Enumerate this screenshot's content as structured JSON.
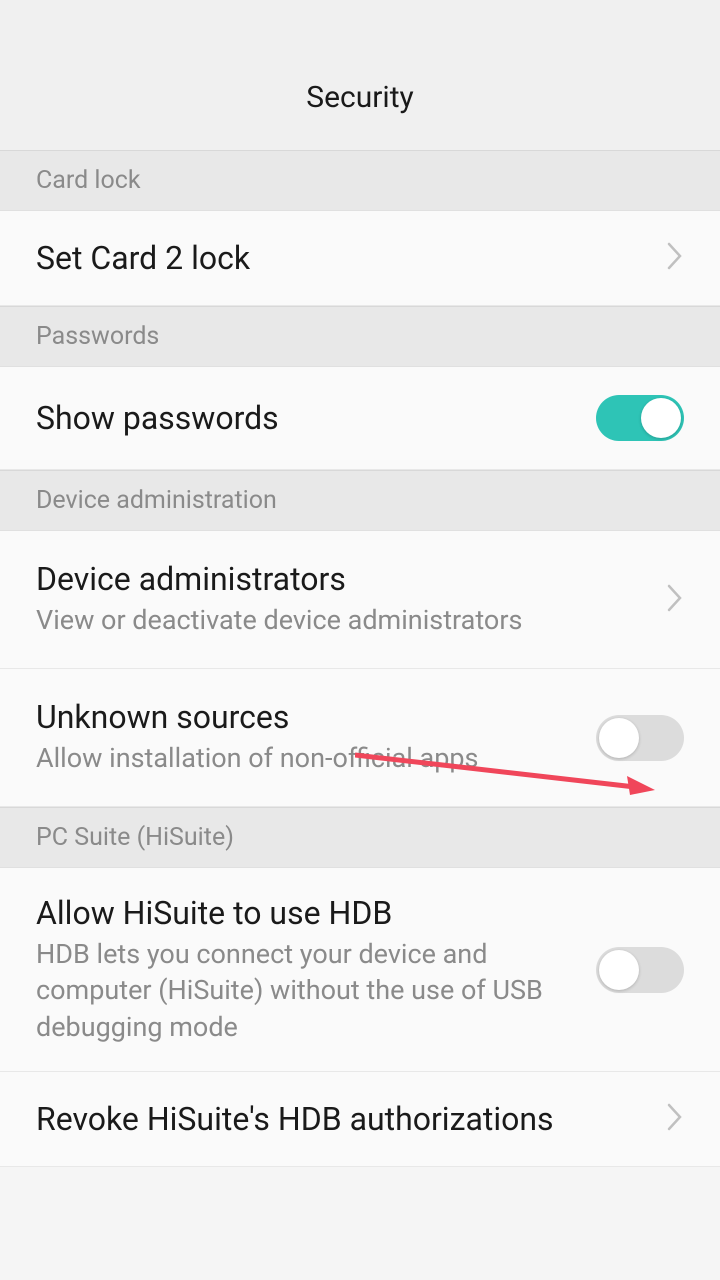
{
  "header": {
    "title": "Security"
  },
  "sections": {
    "cardlock": {
      "label": "Card lock",
      "set_card_lock": "Set Card 2 lock"
    },
    "passwords": {
      "label": "Passwords",
      "show_passwords": "Show passwords",
      "show_passwords_state": "on"
    },
    "device_admin": {
      "label": "Device administration",
      "device_admins_title": "Device administrators",
      "device_admins_subtitle": "View or deactivate device administrators",
      "unknown_sources_title": "Unknown sources",
      "unknown_sources_subtitle": "Allow installation of non-official apps",
      "unknown_sources_state": "off"
    },
    "pcsuite": {
      "label": "PC Suite (HiSuite)",
      "allow_hdb_title": "Allow HiSuite to use HDB",
      "allow_hdb_subtitle": "HDB lets you connect your device and computer (HiSuite) without the use of USB debugging mode",
      "allow_hdb_state": "off",
      "revoke_title": "Revoke HiSuite's HDB authorizations"
    }
  },
  "colors": {
    "toggle_on": "#2ec4b6",
    "annotation_arrow": "#f0465a"
  }
}
